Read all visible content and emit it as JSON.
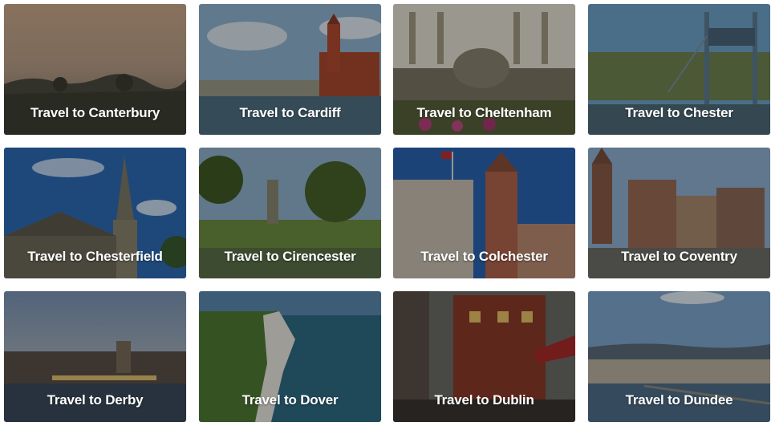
{
  "destinations": [
    {
      "label": "Travel to Canterbury",
      "icon": "canterbury-photo"
    },
    {
      "label": "Travel to Cardiff",
      "icon": "cardiff-photo"
    },
    {
      "label": "Travel to Cheltenham",
      "icon": "cheltenham-photo"
    },
    {
      "label": "Travel to Chester",
      "icon": "chester-photo"
    },
    {
      "label": "Travel to Chesterfield",
      "icon": "chesterfield-photo"
    },
    {
      "label": "Travel to Cirencester",
      "icon": "cirencester-photo"
    },
    {
      "label": "Travel to Colchester",
      "icon": "colchester-photo"
    },
    {
      "label": "Travel to Coventry",
      "icon": "coventry-photo"
    },
    {
      "label": "Travel to Derby",
      "icon": "derby-photo"
    },
    {
      "label": "Travel to Dover",
      "icon": "dover-photo"
    },
    {
      "label": "Travel to Dublin",
      "icon": "dublin-photo"
    },
    {
      "label": "Travel to Dundee",
      "icon": "dundee-photo"
    }
  ],
  "colors": {
    "overlay": "#000000",
    "text": "#ffffff"
  }
}
